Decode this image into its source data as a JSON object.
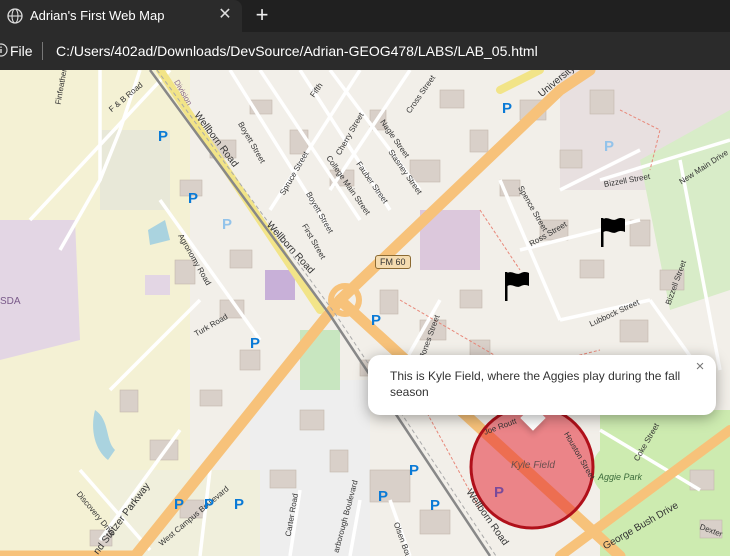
{
  "browser": {
    "tab_title": "Adrian's First Web Map",
    "tab_close": "✕",
    "new_tab": "+",
    "scheme_label": "File",
    "url": "C:/Users/402ad/Downloads/DevSource/Adrian-GEOG478/LABS/LAB_05.html",
    "icons": [
      "globe-icon",
      "info-icon",
      "close-icon",
      "plus-icon"
    ]
  },
  "map": {
    "popup_text": "This is Kyle Field, where the Aggies play during the fall season",
    "popup_close": "×",
    "markers": [
      "flag-icon",
      "flag-icon"
    ],
    "circle_color": "#e0141e",
    "highway_shield": "FM 60",
    "labels": {
      "wellborn_road_1": "Wellborn Road",
      "wellborn_road_2": "Wellborn Road",
      "wellborn_road_3": "Wellborn Road",
      "university": "University",
      "bizzell": "Bizzell Street",
      "bizzell_2": "Bizzell Street",
      "new_main": "New Main Drive",
      "spence": "Spence Street",
      "ross": "Ross Street",
      "lubbock": "Lubbock Street",
      "jones": "Jones Street",
      "houston": "Houston Street",
      "coke": "Coke Street",
      "joe_routt": "Joe Routt",
      "dexter": "Dexter",
      "george_bush": "George Bush Drive",
      "boyett": "Boyett Street",
      "boyett_2": "Boyett Street",
      "spruce": "Spruce Street",
      "first": "First Street",
      "cherry": "Cherry Street",
      "college_main": "College Main Street",
      "nagle": "Nagle Street",
      "stasney": "Stasney Street",
      "fauber": "Fauber Street",
      "cross": "Cross Street",
      "fifth": "Fifth",
      "agronomy": "Agronomy Road",
      "turk": "Turk Road",
      "finfeather": "Finfeather",
      "fb_road": "F & B Road",
      "discovery": "Discovery Drive",
      "west_campus": "West Campus Boulevard",
      "carter": "Carter Road",
      "olsen": "Olsen Boulevard",
      "marsborough": "arborough Boulevard",
      "stotzer": "nd Stotzer Parkway",
      "sda": "SDA",
      "kyle_field": "Kyle Field",
      "aggie_park": "Aggie Park",
      "division": "Division"
    },
    "parking_label": "P"
  }
}
